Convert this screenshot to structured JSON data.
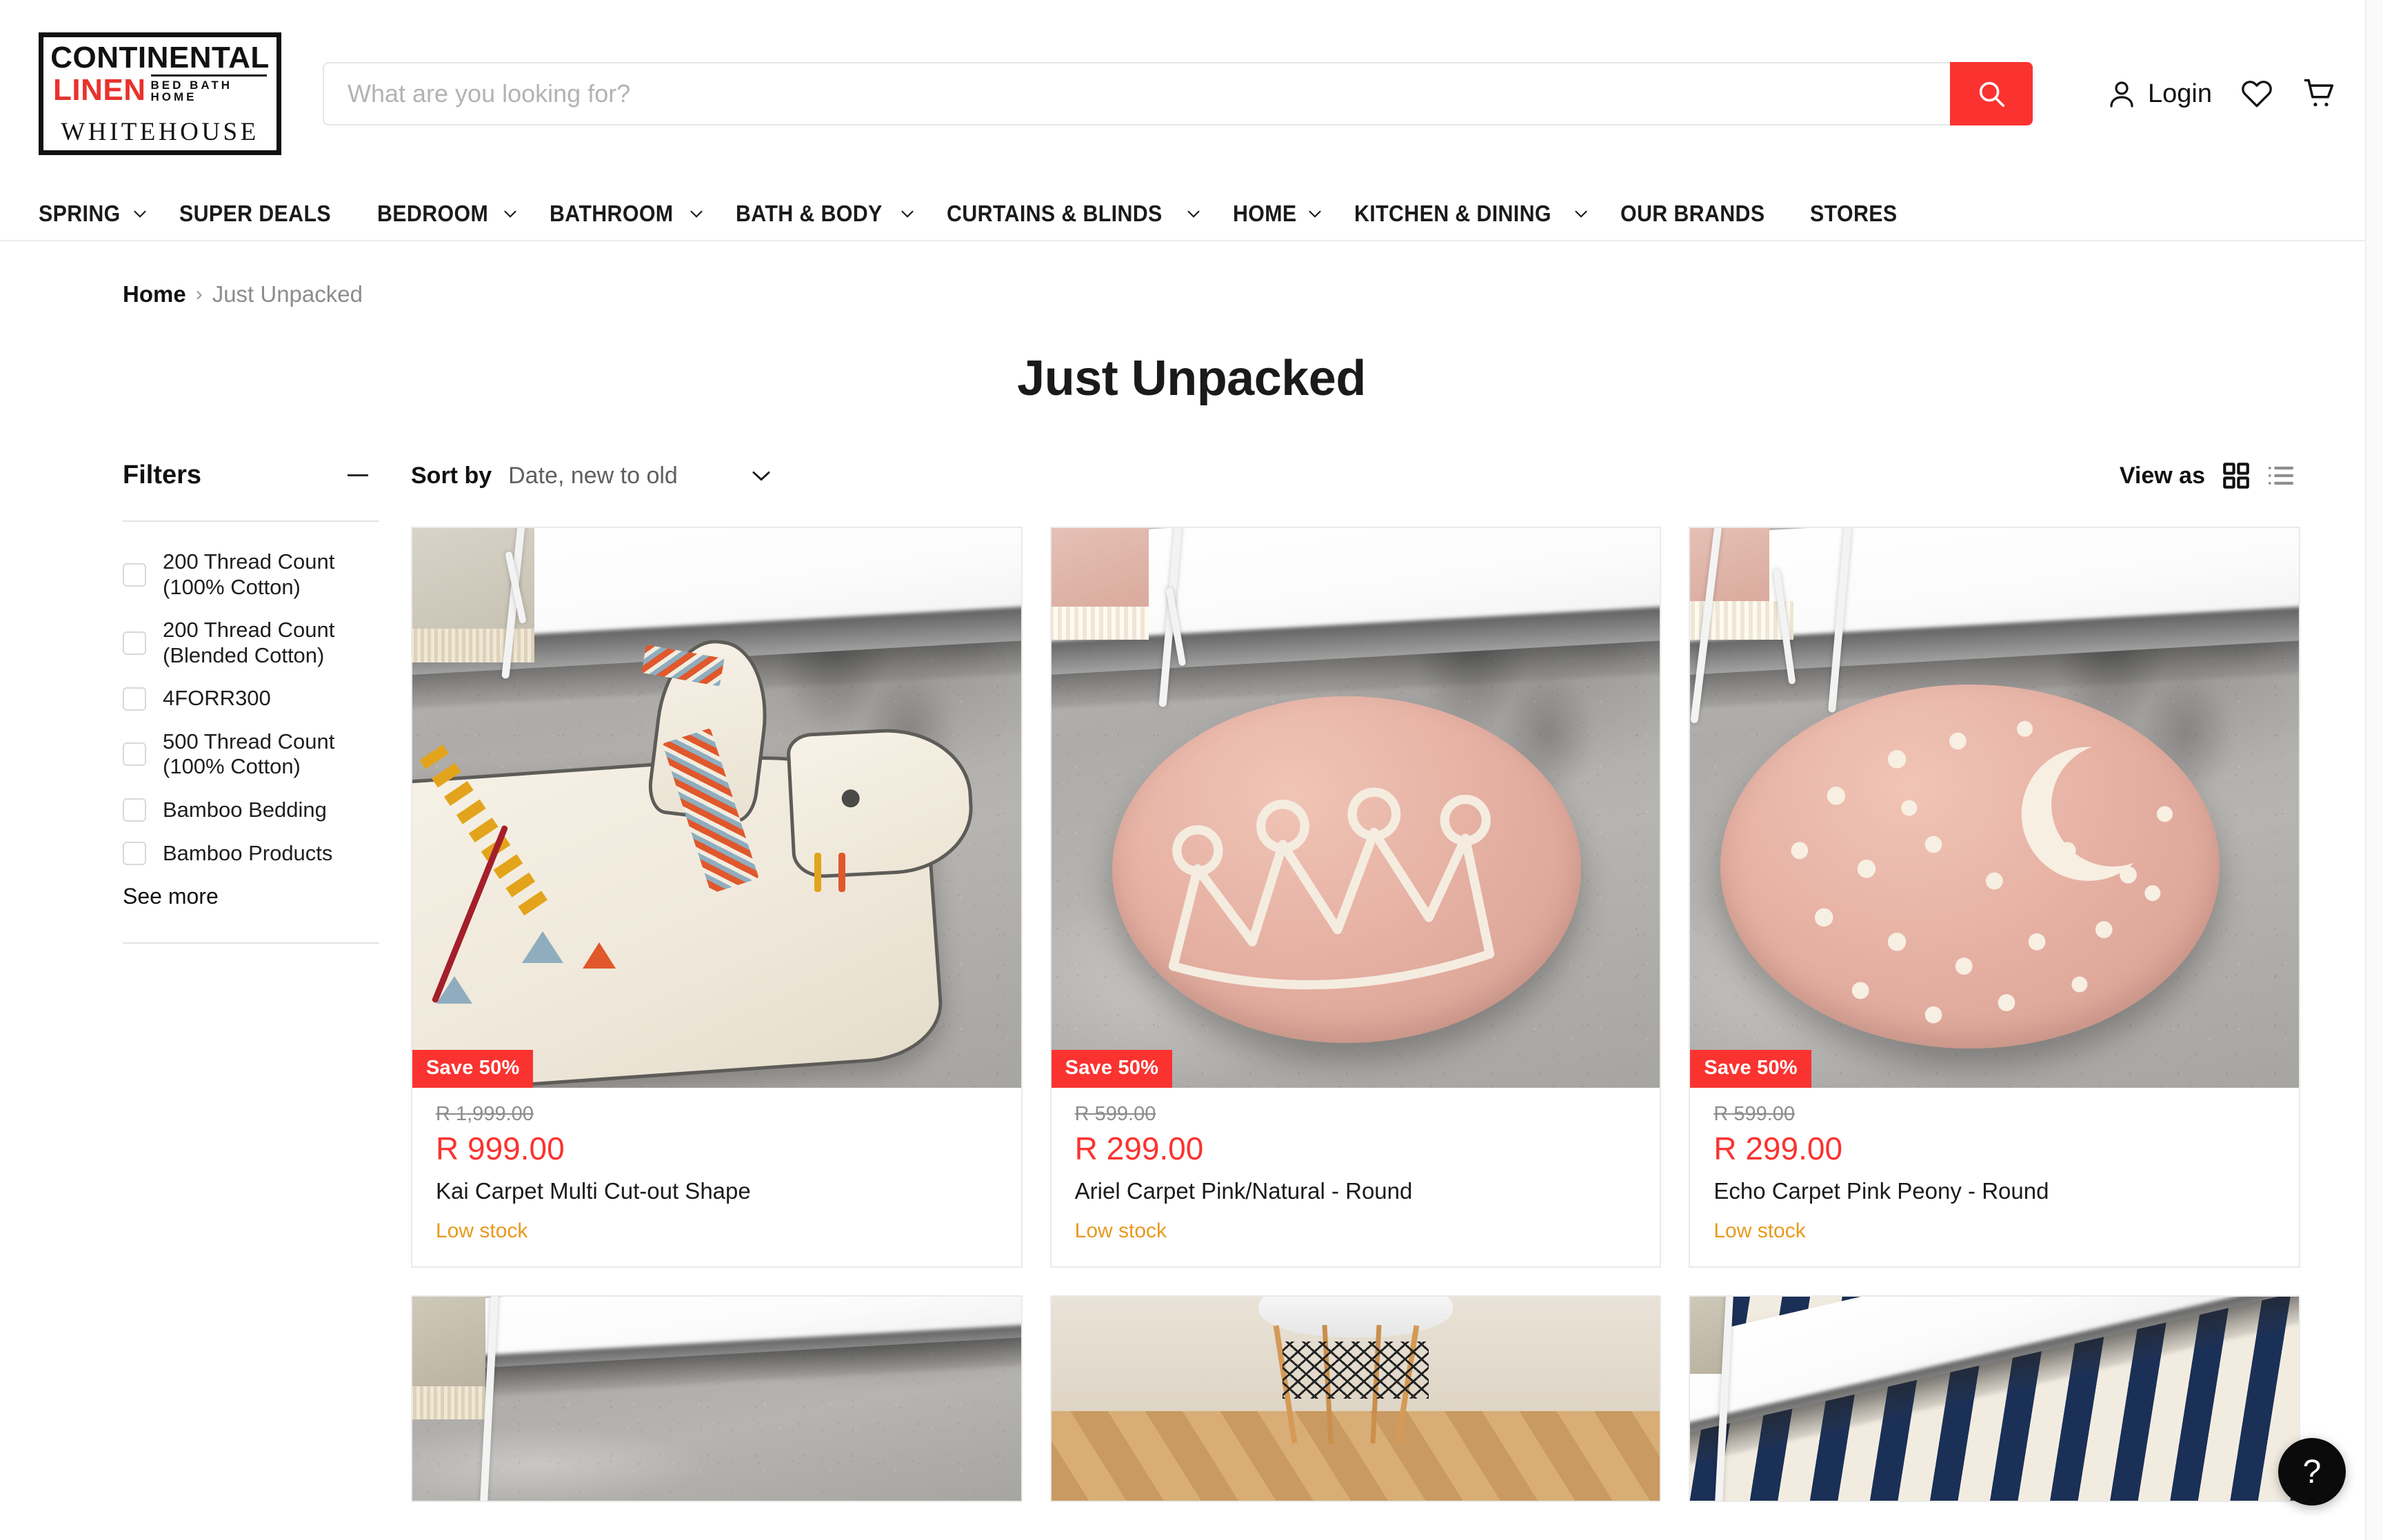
{
  "brand": {
    "line1": "CONTINENTAL",
    "line2": "LINEN",
    "tagline": "BED BATH HOME",
    "line3": "WHITEHOUSE"
  },
  "search": {
    "placeholder": "What are you looking for?",
    "value": "",
    "icon": "search-icon",
    "accent_color": "#fa3330"
  },
  "header": {
    "login_label": "Login",
    "account_icon": "user-icon",
    "wishlist_icon": "heart-icon",
    "cart_icon": "cart-icon"
  },
  "nav": {
    "items": [
      {
        "label": "SPRING",
        "has_dropdown": true
      },
      {
        "label": "SUPER DEALS",
        "has_dropdown": false
      },
      {
        "label": "BEDROOM",
        "has_dropdown": true
      },
      {
        "label": "BATHROOM",
        "has_dropdown": true
      },
      {
        "label": "BATH & BODY",
        "has_dropdown": true
      },
      {
        "label": "CURTAINS & BLINDS",
        "has_dropdown": true
      },
      {
        "label": "HOME",
        "has_dropdown": true
      },
      {
        "label": "KITCHEN & DINING",
        "has_dropdown": true
      },
      {
        "label": "OUR BRANDS",
        "has_dropdown": false
      },
      {
        "label": "STORES",
        "has_dropdown": false
      }
    ]
  },
  "breadcrumb": {
    "home": "Home",
    "separator": "›",
    "current": "Just Unpacked"
  },
  "page": {
    "title": "Just Unpacked"
  },
  "filters": {
    "title": "Filters",
    "collapse_icon": "minus-icon",
    "see_more": "See more",
    "options": [
      {
        "label": "200 Thread Count (100% Cotton)",
        "checked": false
      },
      {
        "label": "200 Thread Count (Blended Cotton)",
        "checked": false
      },
      {
        "label": "4FORR300",
        "checked": false
      },
      {
        "label": "500 Thread Count (100% Cotton)",
        "checked": false
      },
      {
        "label": "Bamboo Bedding",
        "checked": false
      },
      {
        "label": "Bamboo Products",
        "checked": false
      }
    ]
  },
  "toolbar": {
    "sort_label": "Sort by",
    "sort_value": "Date, new to old",
    "sort_options": [
      "Date, new to old"
    ],
    "view_label": "View as",
    "grid_icon": "grid-view-icon",
    "list_icon": "list-view-icon",
    "active_view": "grid"
  },
  "products": [
    {
      "badge": "Save 50%",
      "old_price": "R 1,999.00",
      "price": "R 999.00",
      "title": "Kai Carpet Multi Cut-out Shape",
      "stock": "Low stock",
      "art": "llama-rug"
    },
    {
      "badge": "Save 50%",
      "old_price": "R 599.00",
      "price": "R 299.00",
      "title": "Ariel Carpet Pink/Natural - Round",
      "stock": "Low stock",
      "art": "crown-rug"
    },
    {
      "badge": "Save 50%",
      "old_price": "R 599.00",
      "price": "R 299.00",
      "title": "Echo Carpet Pink Peony - Round",
      "stock": "Low stock",
      "art": "moon-rug"
    }
  ],
  "products_next_row": [
    {
      "art": "concrete-floor"
    },
    {
      "art": "wood-floor-chair"
    },
    {
      "art": "navy-striped-rug"
    }
  ],
  "help": {
    "label": "?"
  },
  "colors": {
    "accent_red": "#fa3330",
    "logo_red": "#e8322c",
    "stock_amber": "#e8991c",
    "text_dark": "#1a1a1a",
    "muted": "#8c8c8c"
  }
}
